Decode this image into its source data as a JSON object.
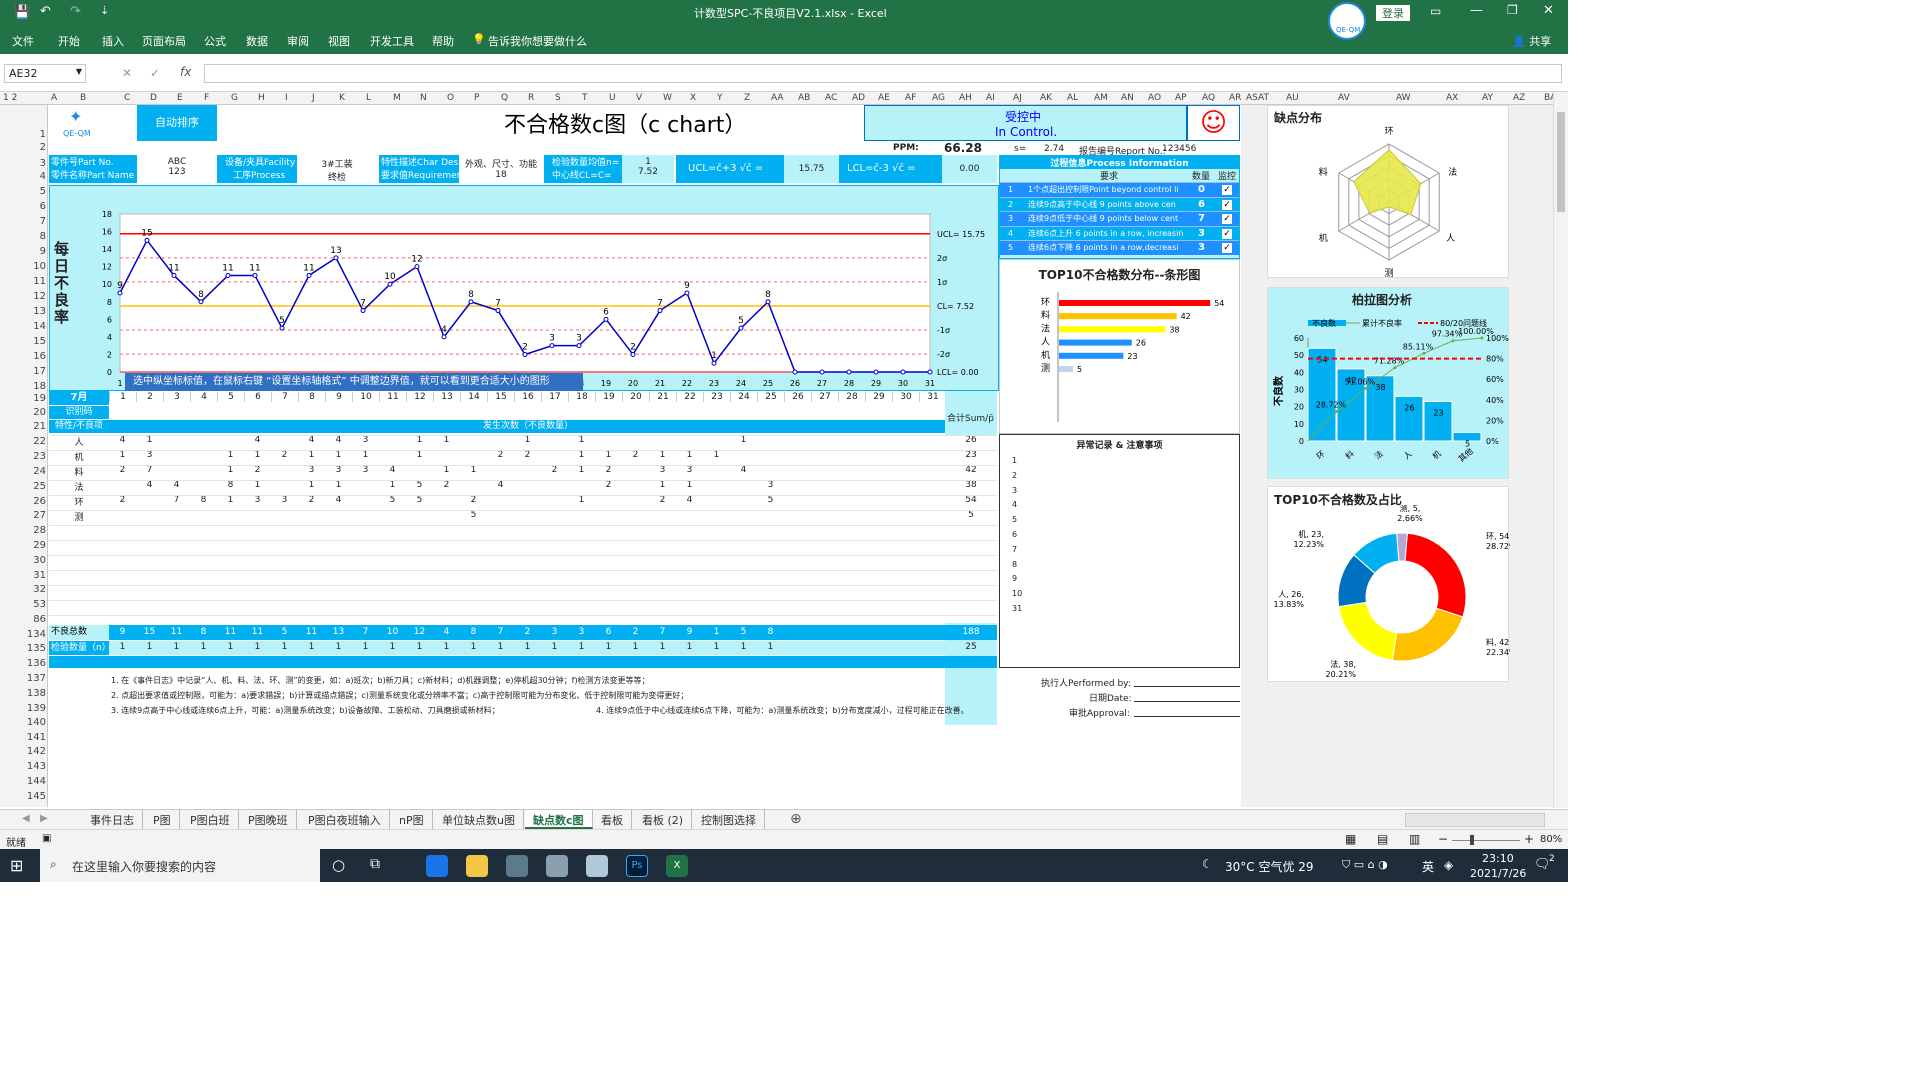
{
  "window": {
    "title": "计数型SPC-不良项目V2.1.xlsx  -  Excel",
    "login": "登录",
    "share": "共享"
  },
  "ribbon": [
    "文件",
    "开始",
    "插入",
    "页面布局",
    "公式",
    "数据",
    "审阅",
    "视图",
    "开发工具",
    "帮助"
  ],
  "tell_me": "告诉我你想要做什么",
  "name_box": "AE32",
  "columns": [
    "A",
    "B",
    "C",
    "D",
    "E",
    "F",
    "G",
    "H",
    "I",
    "J",
    "K",
    "L",
    "M",
    "N",
    "O",
    "P",
    "Q",
    "R",
    "S",
    "T",
    "U",
    "V",
    "W",
    "X",
    "Y",
    "Z",
    "AA",
    "AB",
    "AC",
    "AD",
    "AE",
    "AF",
    "AG",
    "AH",
    "AI",
    "AJ",
    "AK",
    "AL",
    "AM",
    "AN",
    "AO",
    "AP",
    "AQ",
    "AR",
    "AS",
    "AT",
    "AU",
    "AV",
    "AW",
    "AX",
    "AY",
    "AZ",
    "BA"
  ],
  "rows": [
    "1",
    "2",
    "3",
    "4",
    "5",
    "6",
    "7",
    "8",
    "9",
    "10",
    "11",
    "12",
    "13",
    "14",
    "15",
    "16",
    "17",
    "18",
    "19",
    "20",
    "21",
    "22",
    "23",
    "24",
    "25",
    "26",
    "27",
    "28",
    "29",
    "30",
    "31",
    "32",
    "53",
    "86",
    "134",
    "135",
    "136",
    "137",
    "138",
    "139",
    "140",
    "141",
    "142",
    "143",
    "144",
    "145"
  ],
  "header": {
    "logo_text": "QE-QM",
    "auto_sort": "自动排序",
    "chart_title": "不合格数c图（c chart）",
    "status_cn": "受控中",
    "status_en": "In Control.",
    "smile": "☺",
    "ppm_label": "PPM:",
    "ppm": "66.28",
    "s_label": "s=",
    "s": "2.74",
    "report_label": "报告编号Report No.:",
    "report_no": "123456",
    "part_no_label": "零件号Part No.",
    "part_no": "ABC",
    "part_name_label": "零件名称Part Name",
    "part_name": "123",
    "facility_label": "设备/夹具Facility",
    "facility": "3#工装",
    "process_label": "工序Process",
    "process": "终检",
    "char_label": "特性描述Char Des",
    "char": "外观、尺寸、功能",
    "req_label": "要求值Requirement",
    "req": "18",
    "n_label": "检验数量均值n=",
    "n": "1",
    "cl_label": "中心线CL=C=",
    "cl": "7.52",
    "ucl_formula": "UCL=c̄+3 √c̄  =",
    "ucl": "15.75",
    "lcl_formula": "LCL=c̄-3 √c̄  =",
    "lcl": "0.00"
  },
  "control_chart": {
    "ylabel": "每日不良率",
    "xticks": [
      "1",
      "2",
      "3",
      "4",
      "5",
      "6",
      "7",
      "8",
      "9",
      "10",
      "11",
      "12",
      "13",
      "14",
      "15",
      "16",
      "17",
      "18",
      "19",
      "20",
      "21",
      "22",
      "23",
      "24",
      "25",
      "26",
      "27",
      "28",
      "29",
      "30",
      "31"
    ],
    "yticks": [
      "0",
      "2",
      "4",
      "6",
      "8",
      "10",
      "12",
      "14",
      "16",
      "18"
    ],
    "labels": {
      "ucl": "UCL= 15.75",
      "s2": "2σ",
      "s1": "1σ",
      "cl": "CL= 7.52",
      "m1": "-1σ",
      "m2": "-2σ",
      "lcl": "LCL= 0.00"
    },
    "tooltip": "选中纵坐标标值，在鼠标右键 “设置坐标轴格式” 中调整边界值，就可以看到更合适大小的图形"
  },
  "chart_data": [
    {
      "type": "line",
      "title": "不合格数c图（c chart）",
      "x": [
        1,
        2,
        3,
        4,
        5,
        6,
        7,
        8,
        9,
        10,
        11,
        12,
        13,
        14,
        15,
        16,
        17,
        18,
        19,
        20,
        21,
        22,
        23,
        24,
        25,
        26,
        27,
        28,
        29,
        30,
        31
      ],
      "values": [
        9,
        15,
        11,
        8,
        11,
        11,
        5,
        11,
        13,
        7,
        10,
        12,
        4,
        8,
        7,
        2,
        3,
        3,
        6,
        2,
        7,
        9,
        1,
        5,
        8,
        0,
        0,
        0,
        0,
        0,
        0
      ],
      "ylim": [
        0,
        18
      ],
      "ucl": 15.75,
      "cl": 7.52,
      "lcl": 0
    },
    {
      "type": "bar",
      "title": "TOP10不合格数分布--条形图",
      "categories": [
        "环",
        "料",
        "法",
        "人",
        "机",
        "测"
      ],
      "values": [
        54,
        42,
        38,
        26,
        23,
        5
      ]
    },
    {
      "type": "bar",
      "title": "柏拉图分析",
      "ylabel": "不良数",
      "categories": [
        "环",
        "料",
        "法",
        "人",
        "机",
        "其他"
      ],
      "values": [
        54,
        42,
        38,
        26,
        23,
        5
      ],
      "cumulative": [
        28.72,
        51.06,
        71.28,
        85.11,
        97.34,
        100.0
      ],
      "legend": [
        "不良数",
        "累计不良率",
        "80/20问题线"
      ]
    },
    {
      "type": "pie",
      "title": "TOP10不合格数及占比",
      "slices": [
        {
          "label": "环",
          "value": 54,
          "pct": "28.72%"
        },
        {
          "label": "料",
          "value": 42,
          "pct": "22.34%"
        },
        {
          "label": "法",
          "value": 38,
          "pct": "20.21%"
        },
        {
          "label": "人",
          "value": 26,
          "pct": "13.83%"
        },
        {
          "label": "机",
          "value": 23,
          "pct": "12.23%"
        },
        {
          "label": "测",
          "value": 5,
          "pct": "2.66%"
        }
      ]
    }
  ],
  "radar": {
    "title": "缺点分布",
    "axes": [
      "环",
      "料",
      "法",
      "人",
      "机",
      "测"
    ]
  },
  "process_info": {
    "title": "过程信息Process Information",
    "col_req": "要求",
    "col_count": "数量",
    "col_mon": "监控",
    "rules": [
      {
        "no": "1",
        "text": "1个点超出控制限Point beyond control li",
        "count": "0"
      },
      {
        "no": "2",
        "text": "连续9点高于中心线 9 points above cen",
        "count": "6"
      },
      {
        "no": "3",
        "text": "连续9点低于中心线 9 points below cent",
        "count": "7"
      },
      {
        "no": "4",
        "text": "连续6点上升 6 points in a row, increasin",
        "count": "3"
      },
      {
        "no": "5",
        "text": "连续6点下降 6 points in a row,decreasi",
        "count": "3"
      }
    ]
  },
  "bar_title": "TOP10不合格数分布--条形图",
  "anomaly": {
    "title": "异常记录 & 注意事项",
    "rows": [
      "1",
      "2",
      "3",
      "4",
      "5",
      "6",
      "7",
      "8",
      "9",
      "10",
      "31"
    ]
  },
  "table": {
    "month": "7月",
    "r20": "识别码",
    "r21": "特性/不良项",
    "occur": "发生次数（不良数量）",
    "sum": "合计Sum/p̄",
    "days": [
      "1",
      "2",
      "3",
      "4",
      "5",
      "6",
      "7",
      "8",
      "9",
      "10",
      "11",
      "12",
      "13",
      "14",
      "15",
      "16",
      "17",
      "18",
      "19",
      "20",
      "21",
      "22",
      "23",
      "24",
      "25",
      "26",
      "27",
      "28",
      "29",
      "30",
      "31"
    ],
    "items": [
      {
        "name": "人",
        "vals": [
          "4",
          "1",
          "",
          "",
          "",
          "4",
          "",
          "4",
          "4",
          "3",
          "",
          "1",
          "1",
          "",
          "",
          "1",
          "",
          "1",
          "",
          "",
          "",
          "",
          "",
          "1",
          "",
          "",
          "",
          "",
          "",
          "",
          ""
        ],
        "sum": "26"
      },
      {
        "name": "机",
        "vals": [
          "1",
          "3",
          "",
          "",
          "1",
          "1",
          "2",
          "1",
          "1",
          "1",
          "",
          "1",
          "",
          "",
          "2",
          "2",
          "",
          "1",
          "1",
          "2",
          "1",
          "1",
          "1",
          "",
          "",
          "",
          "",
          "",
          "",
          "",
          ""
        ],
        "sum": "23"
      },
      {
        "name": "料",
        "vals": [
          "2",
          "7",
          "",
          "",
          "1",
          "2",
          "",
          "3",
          "3",
          "3",
          "4",
          "",
          "1",
          "1",
          "",
          "",
          "2",
          "1",
          "2",
          "",
          "3",
          "3",
          "",
          "4",
          "",
          "",
          "",
          "",
          "",
          "",
          ""
        ],
        "sum": "42"
      },
      {
        "name": "法",
        "vals": [
          "",
          "4",
          "4",
          "",
          "8",
          "1",
          "",
          "1",
          "1",
          "",
          "1",
          "5",
          "2",
          "",
          "4",
          "",
          "",
          "",
          "2",
          "",
          "1",
          "1",
          "",
          "",
          "3",
          "",
          "",
          "",
          "",
          "",
          ""
        ],
        "sum": "38"
      },
      {
        "name": "环",
        "vals": [
          "2",
          "",
          "7",
          "8",
          "1",
          "3",
          "3",
          "2",
          "4",
          "",
          "5",
          "5",
          "",
          "2",
          "",
          "",
          "",
          "1",
          "",
          "",
          "2",
          "4",
          "",
          "",
          "5",
          "",
          "",
          "",
          "",
          "",
          ""
        ],
        "sum": "54"
      },
      {
        "name": "测",
        "vals": [
          "",
          "",
          "",
          "",
          "",
          "",
          "",
          "",
          "",
          "",
          "",
          "",
          "",
          "5",
          "",
          "",
          "",
          "",
          "",
          "",
          "",
          "",
          "",
          "",
          "",
          "",
          "",
          "",
          "",
          "",
          ""
        ],
        "sum": "5"
      }
    ],
    "total_label": "不良总数（np）",
    "totals": [
      "9",
      "15",
      "11",
      "8",
      "11",
      "11",
      "5",
      "11",
      "13",
      "7",
      "10",
      "12",
      "4",
      "8",
      "7",
      "2",
      "3",
      "3",
      "6",
      "2",
      "7",
      "9",
      "1",
      "5",
      "8",
      "",
      "",
      "",
      "",
      "",
      ""
    ],
    "total_sum": "188",
    "insp_label": "检验数量（n）",
    "insp": [
      "1",
      "1",
      "1",
      "1",
      "1",
      "1",
      "1",
      "1",
      "1",
      "1",
      "1",
      "1",
      "1",
      "1",
      "1",
      "1",
      "1",
      "1",
      "1",
      "1",
      "1",
      "1",
      "1",
      "1",
      "1",
      "",
      "",
      "",
      "",
      "",
      ""
    ],
    "insp_sum": "25"
  },
  "notes": [
    "1. 在《事件日志》中记录“人、机、料、法、环、测”的变更，如：a)班次；b)新刀具；c)新材料；d)机器调整；e)停机超30分钟；f)检测方法变更等等；",
    "2. 点超出要求值或控制限，可能为：a)要求錯誤；b)计算或描点錯誤；c)测量系统变化或分辨率不當；c)高于控制限可能为分布变化、低于控制限可能为变得更好；",
    "3. 连续9点高于中心线或连续6点上升，可能：a)测量系统改变；b)设备故障、工装松动、刀具磨损或新材料；",
    "4. 连续9点低于中心线或连续6点下降，可能为：a)测量系统改变；b)分布宽度减小，过程可能正在改善。"
  ],
  "signoff": {
    "performed": "执行人Performed by:",
    "date": "日期Date:",
    "approval": "审批Approval:"
  },
  "sheet_tabs": [
    "事件日志",
    "P图",
    "P图白班",
    "P图晚班",
    "P图白夜班输入",
    "nP图",
    "单位缺点数u图",
    "缺点数c图",
    "看板",
    "看板 (2)",
    "控制图选择"
  ],
  "active_tab": "缺点数c图",
  "status": {
    "left": "就绪",
    "zoom": "80%"
  },
  "taskbar": {
    "search": "在这里输入你要搜索的内容",
    "weather": "30°C 空气优 29",
    "ime": "英",
    "time": "23:10",
    "date": "2021/7/26",
    "notif": "2"
  },
  "colors": {
    "excel_green": "#217346",
    "cyan": "#00b0f0",
    "light_cyan": "#b7f2f9",
    "ucl_red": "#ff0000",
    "cl_orange": "#ffc000",
    "series_blue": "#0000cc"
  }
}
